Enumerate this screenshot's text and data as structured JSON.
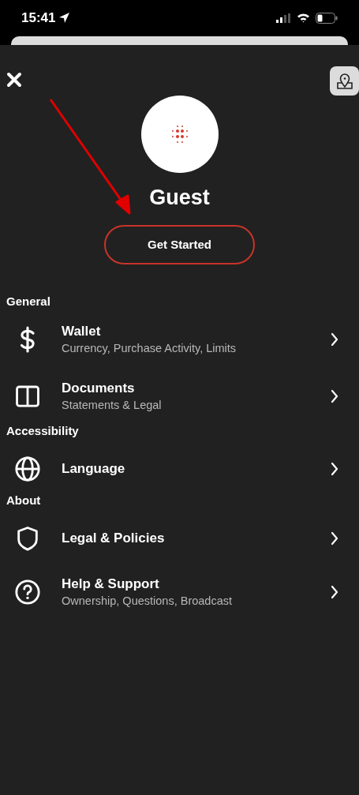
{
  "status_bar": {
    "time": "15:41"
  },
  "profile": {
    "name": "Guest",
    "button": "Get Started"
  },
  "sections": [
    {
      "title": "General",
      "items": [
        {
          "title": "Wallet",
          "subtitle": "Currency, Purchase Activity, Limits"
        },
        {
          "title": "Documents",
          "subtitle": "Statements & Legal"
        }
      ]
    },
    {
      "title": "Accessibility",
      "items": [
        {
          "title": "Language"
        }
      ]
    },
    {
      "title": "About",
      "items": [
        {
          "title": "Legal & Policies"
        },
        {
          "title": "Help & Support",
          "subtitle": "Ownership, Questions, Broadcast"
        }
      ]
    }
  ]
}
